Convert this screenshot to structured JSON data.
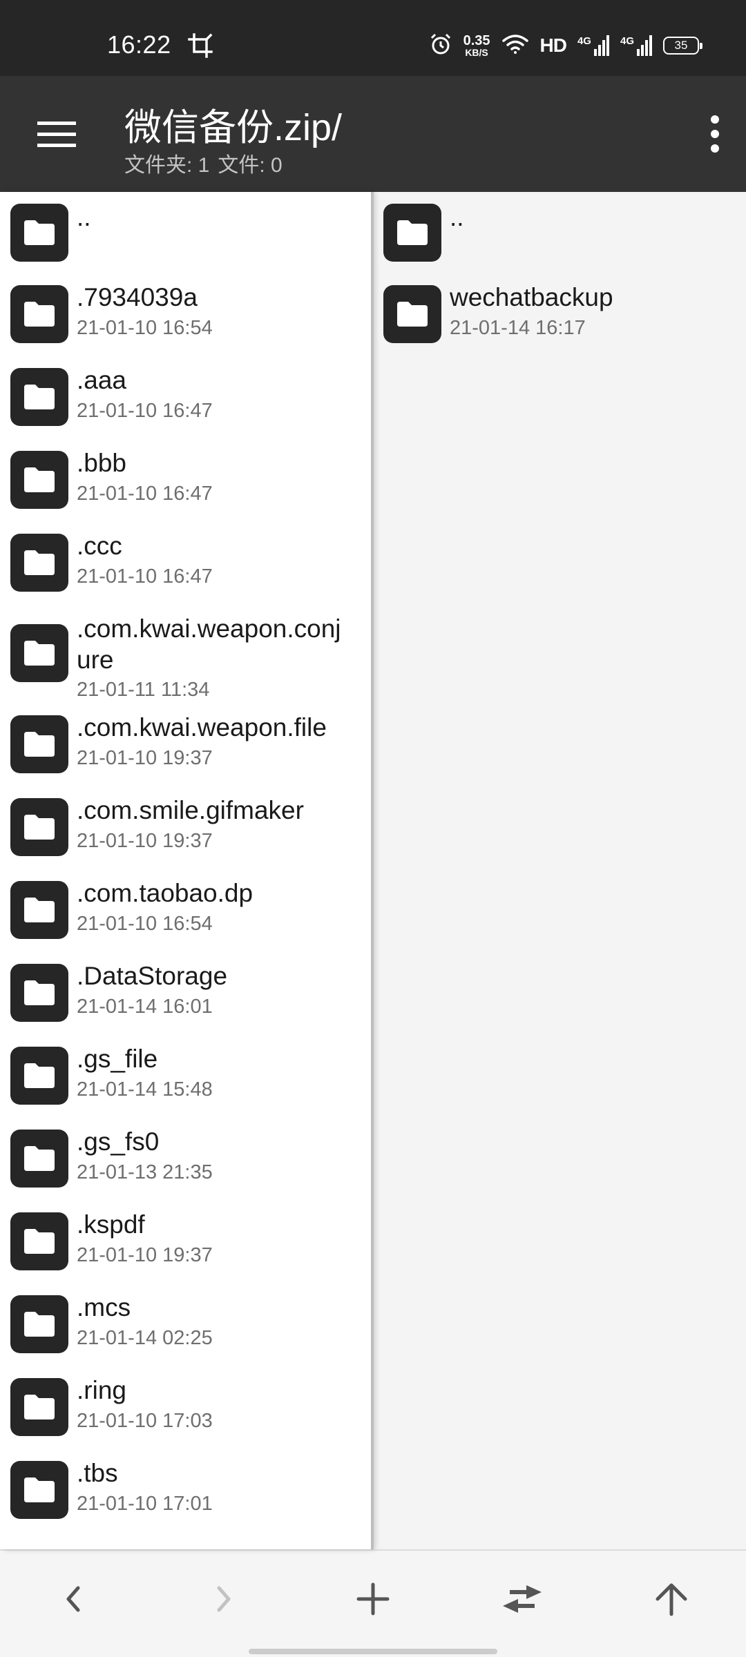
{
  "status_bar": {
    "time": "16:22",
    "net_speed_value": "0.35",
    "net_speed_unit": "KB/S",
    "hd_label": "HD",
    "signal1_label": "4G",
    "signal2_label": "4G",
    "battery_level": "35",
    "icons": [
      "crop-rotate-icon",
      "alarm-icon",
      "wifi-icon",
      "signal-icon",
      "battery-icon"
    ]
  },
  "app_bar": {
    "title": "微信备份.zip/",
    "folders_label": "文件夹: 1",
    "files_label": "文件: 0"
  },
  "left_pane": {
    "items": [
      {
        "name": "..",
        "date": ""
      },
      {
        "name": ".7934039a",
        "date": "21-01-10 16:54"
      },
      {
        "name": ".aaa",
        "date": "21-01-10 16:47"
      },
      {
        "name": ".bbb",
        "date": "21-01-10 16:47"
      },
      {
        "name": ".ccc",
        "date": "21-01-10 16:47"
      },
      {
        "name": ".com.kwai.weapon.conjure",
        "name_line1": ".com.kwai.weapon.conj",
        "name_line2": "ure",
        "date": "21-01-11 11:34"
      },
      {
        "name": ".com.kwai.weapon.file",
        "date": "21-01-10 19:37"
      },
      {
        "name": ".com.smile.gifmaker",
        "date": "21-01-10 19:37"
      },
      {
        "name": ".com.taobao.dp",
        "date": "21-01-10 16:54"
      },
      {
        "name": ".DataStorage",
        "date": "21-01-14 16:01"
      },
      {
        "name": ".gs_file",
        "date": "21-01-14 15:48"
      },
      {
        "name": ".gs_fs0",
        "date": "21-01-13 21:35"
      },
      {
        "name": ".kspdf",
        "date": "21-01-10 19:37"
      },
      {
        "name": ".mcs",
        "date": "21-01-14 02:25"
      },
      {
        "name": ".ring",
        "date": "21-01-10 17:03"
      },
      {
        "name": ".tbs",
        "date": "21-01-10 17:01"
      }
    ]
  },
  "right_pane": {
    "items": [
      {
        "name": "..",
        "date": ""
      },
      {
        "name": "wechatbackup",
        "date": "21-01-14 16:17"
      }
    ]
  },
  "colors": {
    "status_bar_bg": "#262626",
    "app_bar_bg": "#333333",
    "folder_badge_bg": "#262626",
    "date_text": "#6e6e6e"
  }
}
